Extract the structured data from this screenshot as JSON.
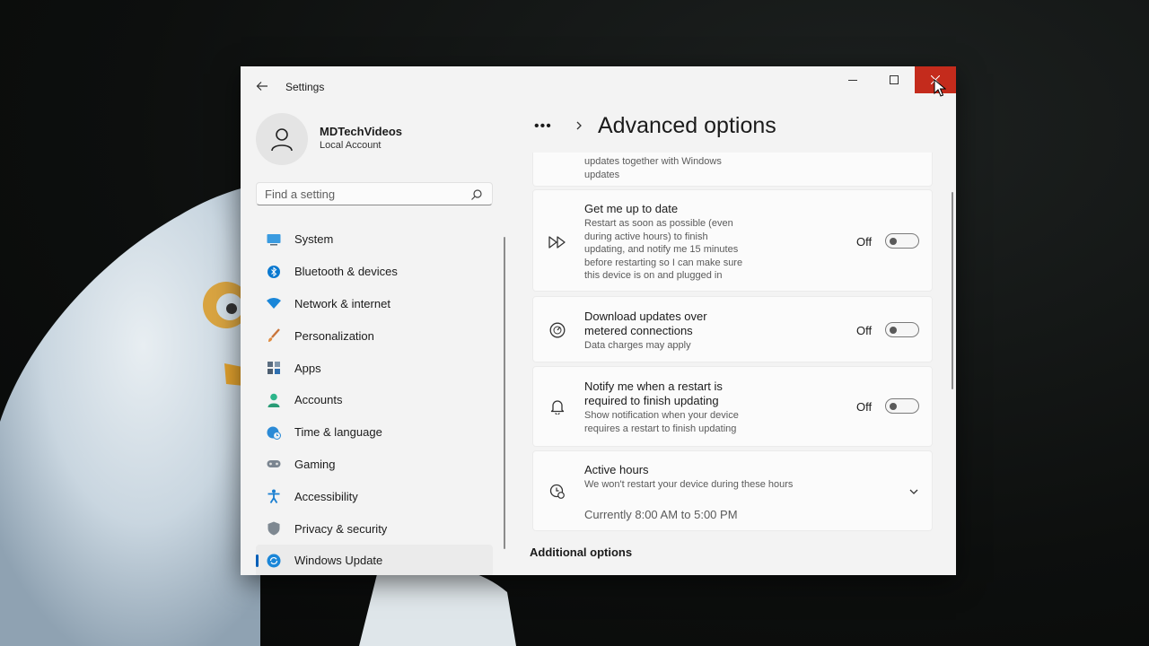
{
  "window": {
    "title": "Settings"
  },
  "user": {
    "name": "MDTechVideos",
    "account_type": "Local Account"
  },
  "search": {
    "placeholder": "Find a setting"
  },
  "sidebar": {
    "items": [
      {
        "label": "System",
        "icon": "system-icon",
        "color": "#0078d4"
      },
      {
        "label": "Bluetooth & devices",
        "icon": "bluetooth-icon",
        "color": "#0078d4"
      },
      {
        "label": "Network & internet",
        "icon": "wifi-icon",
        "color": "#0078d4"
      },
      {
        "label": "Personalization",
        "icon": "brush-icon",
        "color": "#c05a2b"
      },
      {
        "label": "Apps",
        "icon": "apps-icon",
        "color": "#4a5a6a"
      },
      {
        "label": "Accounts",
        "icon": "person-icon",
        "color": "#2ea87a"
      },
      {
        "label": "Time & language",
        "icon": "globe-clock-icon",
        "color": "#0078d4"
      },
      {
        "label": "Gaming",
        "icon": "gamepad-icon",
        "color": "#6b6b6b"
      },
      {
        "label": "Accessibility",
        "icon": "accessibility-icon",
        "color": "#0078d4"
      },
      {
        "label": "Privacy & security",
        "icon": "shield-icon",
        "color": "#6b6b6b"
      },
      {
        "label": "Windows Update",
        "icon": "update-icon",
        "color": "#0078d4",
        "active": true
      }
    ]
  },
  "main": {
    "breadcrumb_ellipsis": "•••",
    "page_title": "Advanced options",
    "partial_card_desc": "updates together with Windows\nupdates",
    "cards": [
      {
        "title": "Get me up to date",
        "desc": "Restart as soon as possible (even\nduring active hours) to finish\nupdating, and notify me 15 minutes\nbefore restarting so I can make sure\nthis device is on and plugged in",
        "icon": "fast-forward-icon",
        "toggle_label": "Off",
        "toggle_on": false
      },
      {
        "title": "Download updates over\nmetered connections",
        "desc": "Data charges may apply",
        "icon": "speedometer-icon",
        "toggle_label": "Off",
        "toggle_on": false
      },
      {
        "title": "Notify me when a restart is\nrequired to finish updating",
        "desc": "Show notification when your device\nrequires a restart to finish updating",
        "icon": "bell-icon",
        "toggle_label": "Off",
        "toggle_on": false
      }
    ],
    "active_hours": {
      "title": "Active hours",
      "desc": "We won't restart your device during these hours",
      "current": "Currently 8:00 AM to 5:00 PM",
      "icon": "clock-settings-icon"
    },
    "section_additional": "Additional options"
  },
  "colors": {
    "accent": "#005fb8",
    "close_button": "#c42b1c",
    "window_bg": "#f3f3f3",
    "card_bg": "#fbfbfb"
  }
}
